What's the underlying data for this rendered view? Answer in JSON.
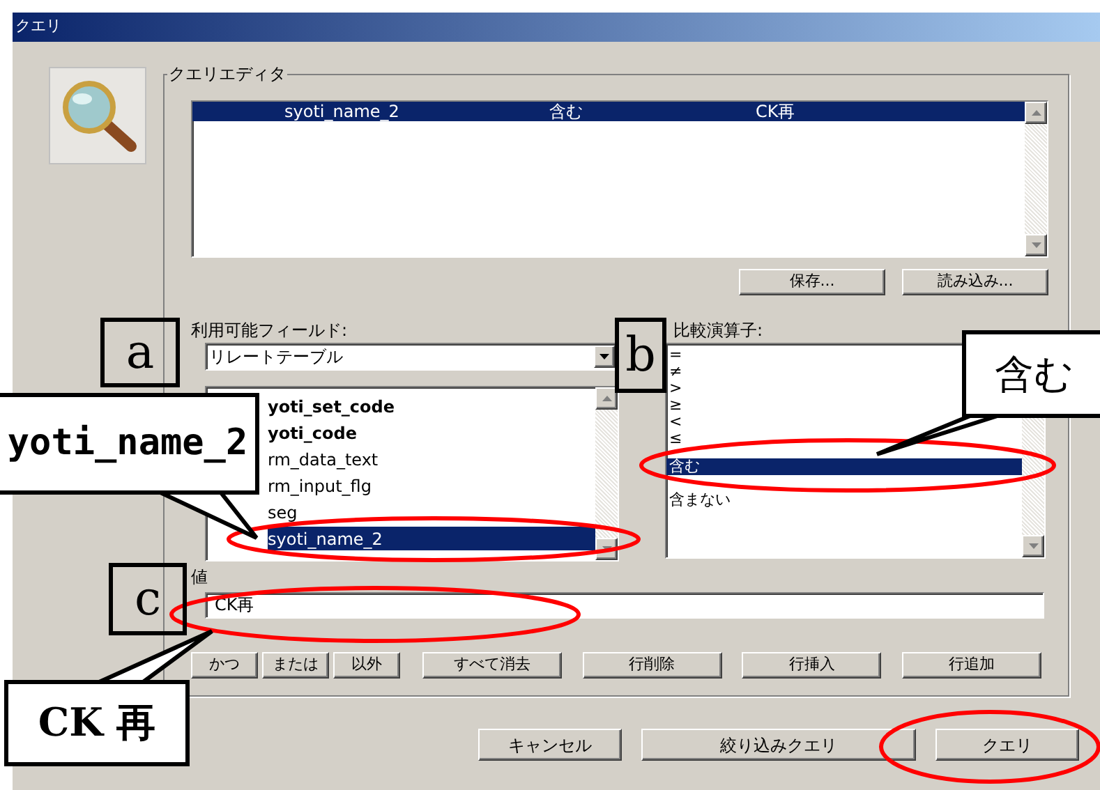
{
  "window": {
    "title": "クエリ"
  },
  "query_editor": {
    "title": "クエリエディタ",
    "rows": [
      {
        "field": "syoti_name_2",
        "operator": "含む",
        "value": "CK再",
        "selected": true
      }
    ],
    "buttons": [
      "保存...",
      "読み込み..."
    ]
  },
  "available_fields": {
    "label": "利用可能フィールド:",
    "table_select": {
      "value": "リレートテーブル"
    },
    "fields": [
      {
        "name": "yoti_set_code",
        "bold": true,
        "selected": false
      },
      {
        "name": "yoti_code",
        "bold": true,
        "selected": false
      },
      {
        "name": "rm_data_text",
        "bold": false,
        "selected": false
      },
      {
        "name": "rm_input_flg",
        "bold": false,
        "selected": false
      },
      {
        "name": "seg",
        "bold": false,
        "selected": false
      },
      {
        "name": "syoti_name_2",
        "bold": false,
        "selected": true
      }
    ]
  },
  "operators": {
    "label": "比較演算子:",
    "items": [
      {
        "label": "=",
        "selected": false
      },
      {
        "label": "≠",
        "selected": false
      },
      {
        "label": ">",
        "selected": false
      },
      {
        "label": "≥",
        "selected": false
      },
      {
        "label": "<",
        "selected": false
      },
      {
        "label": "≤",
        "selected": false
      },
      {
        "label": "含む",
        "selected": true
      },
      {
        "label": "含まない",
        "selected": false
      }
    ]
  },
  "value_field": {
    "label": "値",
    "value": "CK再"
  },
  "logic_buttons": [
    "かつ",
    "または",
    "以外"
  ],
  "row_buttons": [
    "すべて消去",
    "行削除",
    "行挿入",
    "行追加"
  ],
  "dialog_buttons": [
    "キャンセル",
    "絞り込みクエリ",
    "クエリ"
  ],
  "annotations": {
    "letter_boxes": [
      "a",
      "b",
      "c"
    ],
    "callouts": [
      {
        "text": "yoti_name_2"
      },
      {
        "text": "含む"
      },
      {
        "text": "CK 再"
      }
    ]
  }
}
